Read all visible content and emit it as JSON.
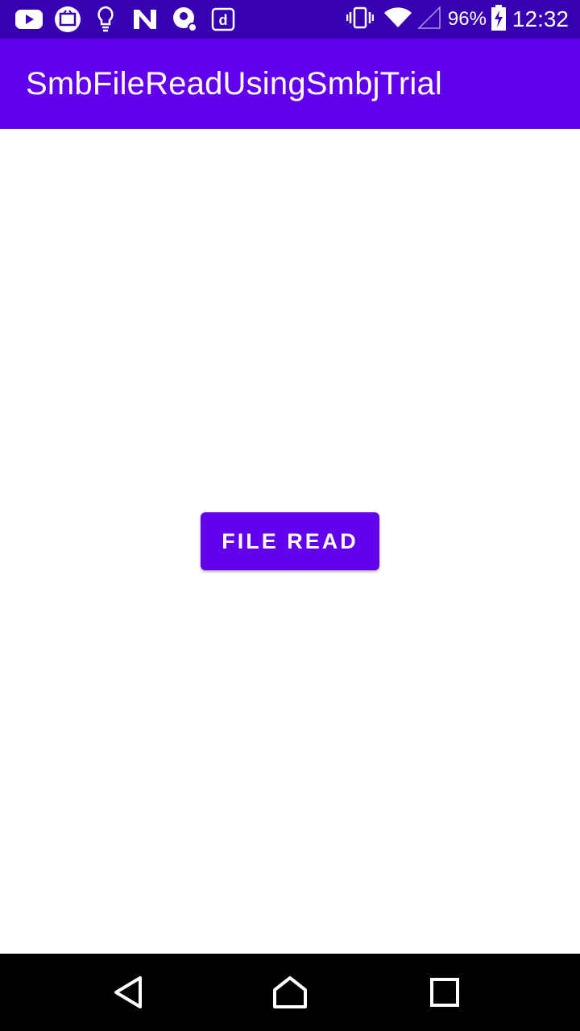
{
  "status_bar": {
    "battery_percent": "96%",
    "time": "12:32",
    "notification_icons": [
      "youtube-icon",
      "tv-icon",
      "bulb-icon",
      "n-app-icon",
      "sync-app-icon",
      "d-app-icon"
    ],
    "system_icons": [
      "vibrate-icon",
      "wifi-icon",
      "signal-icon",
      "battery-charging-icon"
    ],
    "background_color": "#3700B3"
  },
  "app_bar": {
    "title": "SmbFileReadUsingSmbjTrial",
    "background_color": "#6200EE"
  },
  "main": {
    "file_read_button_label": "FILE READ",
    "button_color": "#6200EE"
  },
  "nav_bar": {
    "buttons": [
      "back-icon",
      "home-icon",
      "recents-icon"
    ]
  }
}
